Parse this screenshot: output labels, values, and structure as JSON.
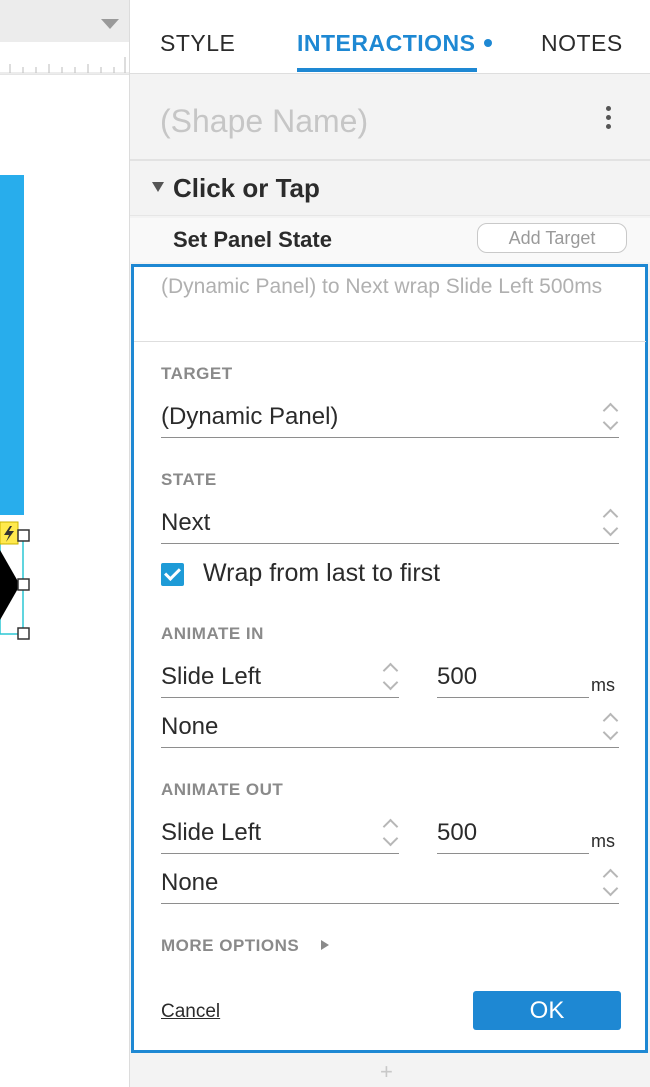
{
  "tabs": {
    "style": "STYLE",
    "interactions": "INTERACTIONS",
    "notes": "NOTES",
    "active": "interactions"
  },
  "shape_name": {
    "placeholder": "(Shape Name)"
  },
  "event": {
    "name": "Click or Tap",
    "expanded": true
  },
  "action": {
    "name": "Set Panel State",
    "add_target_label": "Add Target"
  },
  "editor": {
    "summary": "(Dynamic Panel) to Next wrap Slide Left 500ms",
    "target_label": "TARGET",
    "target_value": "(Dynamic Panel)",
    "state_label": "STATE",
    "state_value": "Next",
    "wrap_label": "Wrap from last to first",
    "wrap_checked": true,
    "animate_in_label": "ANIMATE IN",
    "animate_in_type": "Slide Left",
    "animate_in_duration": "500",
    "animate_in_unit": "ms",
    "animate_in_easing": "None",
    "animate_out_label": "ANIMATE OUT",
    "animate_out_type": "Slide Left",
    "animate_out_duration": "500",
    "animate_out_unit": "ms",
    "animate_out_easing": "None",
    "more_options_label": "MORE OPTIONS",
    "cancel_label": "Cancel",
    "ok_label": "OK"
  },
  "footer": {
    "add_symbol": "+"
  },
  "colors": {
    "accent": "#1e88d3",
    "canvas_shape": "#28adec",
    "checkbox": "#1e9bd7",
    "lightning_badge": "#ffe94d",
    "selection": "#2bc7d4"
  },
  "icons": {
    "menu": "kebab-icon",
    "event_caret": "caret-down-icon",
    "more_options_caret": "caret-right-icon",
    "dropdown": "up-down-chevron-icon",
    "interaction_badge": "lightning-icon",
    "toolbar_dropdown": "caret-down-icon"
  }
}
